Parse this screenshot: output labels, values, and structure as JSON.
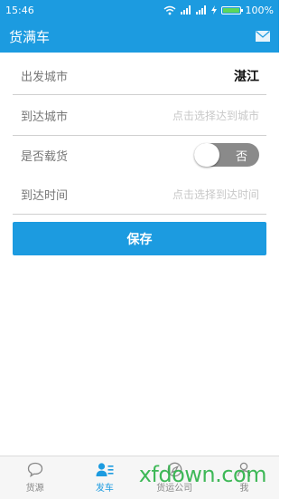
{
  "status_bar": {
    "time": "15:46",
    "battery_percent": "100%",
    "battery_level": 1.0,
    "icons": [
      "wifi-icon",
      "signal-icon",
      "signal-icon",
      "charging-icon",
      "battery-icon"
    ]
  },
  "header": {
    "title": "货满车",
    "icon": "mail-icon"
  },
  "form": {
    "departure": {
      "label": "出发城市",
      "value": "湛江"
    },
    "arrival": {
      "label": "到达城市",
      "placeholder": "点击选择达到城市"
    },
    "loaded": {
      "label": "是否载货",
      "toggle_text": "否",
      "toggle_on": false
    },
    "arrival_time": {
      "label": "到达时间",
      "placeholder": "点击选择到达时间"
    }
  },
  "save_label": "保存",
  "tabs": [
    {
      "label": "货源",
      "icon": "chat-bubble-icon",
      "active": false
    },
    {
      "label": "发车",
      "icon": "user-list-icon",
      "active": true
    },
    {
      "label": "货运公司",
      "icon": "compass-icon",
      "active": false
    },
    {
      "label": "我",
      "icon": "person-icon",
      "active": false
    }
  ],
  "watermark": "xfdown.com",
  "colors": {
    "accent": "#1c9be0",
    "toggle_off": "#8a8a8a",
    "watermark": "#2fb34a"
  }
}
